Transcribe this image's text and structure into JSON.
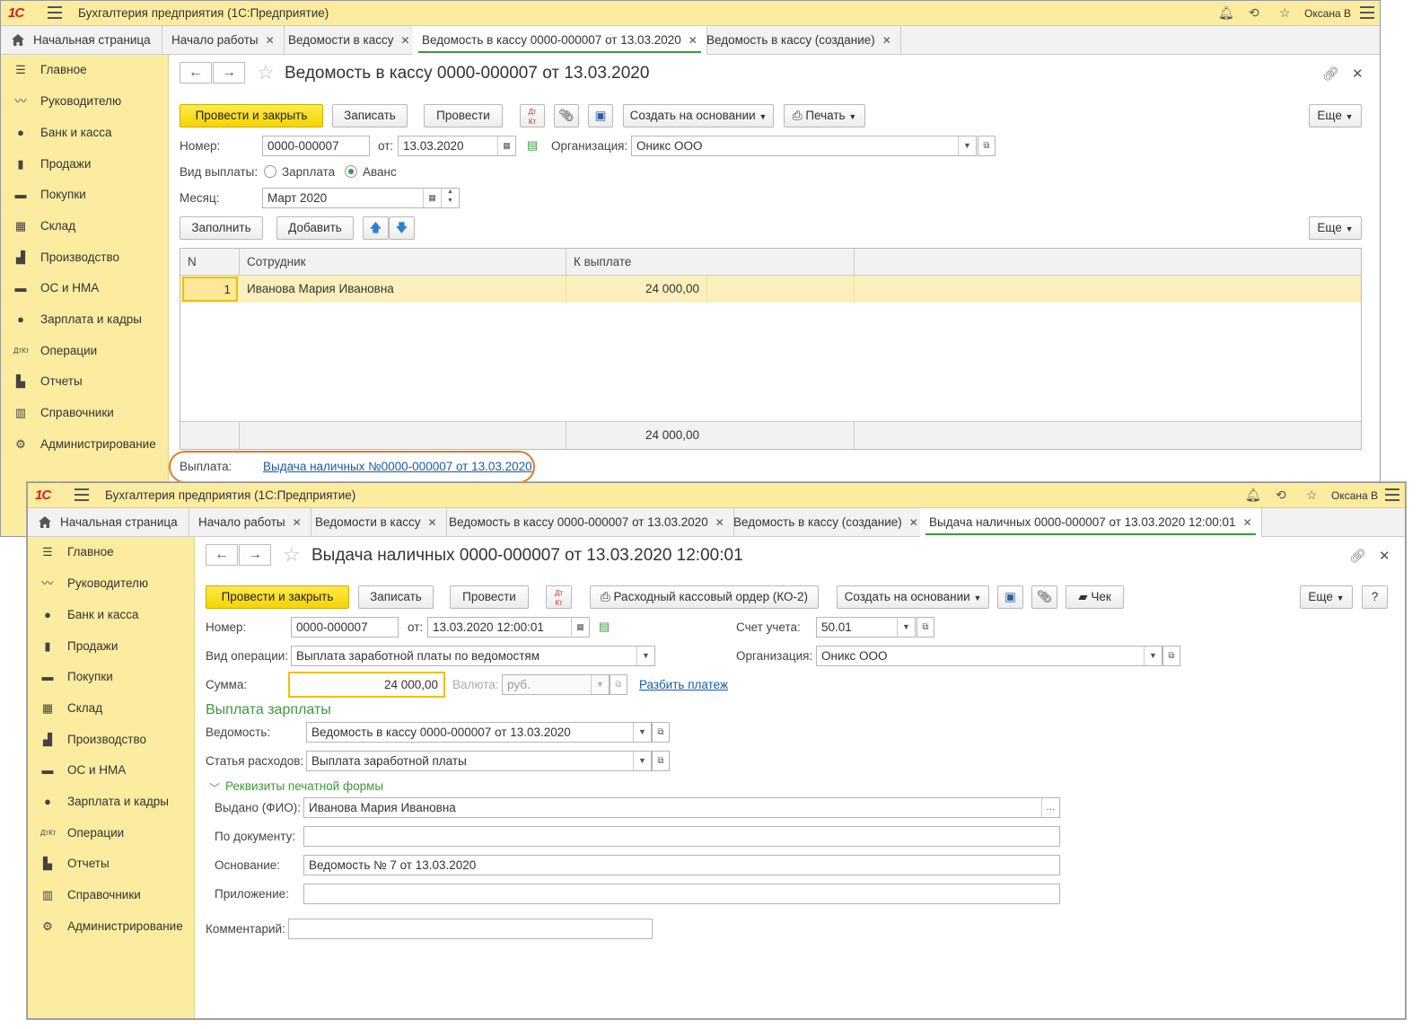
{
  "w1": {
    "app_title": "Бухгалтерия предприятия  (1С:Предприятие)",
    "user": "Оксана В",
    "home": "Начальная страница",
    "tabs": [
      "Начало работы",
      "Ведомости в кассу",
      "Ведомость в кассу 0000-000007 от 13.03.2020",
      "Ведомость в кассу (создание)"
    ],
    "sidebar": [
      "Главное",
      "Руководителю",
      "Банк и касса",
      "Продажи",
      "Покупки",
      "Склад",
      "Производство",
      "ОС и НМА",
      "Зарплата и кадры",
      "Операции",
      "Отчеты",
      "Справочники",
      "Администрирование"
    ],
    "doc_title": "Ведомость в кассу 0000-000007 от 13.03.2020",
    "btn_post_close": "Провести и закрыть",
    "btn_save": "Записать",
    "btn_post": "Провести",
    "btn_create_based": "Создать на основании",
    "btn_print": "Печать",
    "btn_more": "Еще",
    "number_label": "Номер:",
    "number": "0000-000007",
    "date_label": "от:",
    "date": "13.03.2020",
    "org_label": "Организация:",
    "org": "Оникс ООО",
    "pay_type_label": "Вид выплаты:",
    "pay_type_salary": "Зарплата",
    "pay_type_advance": "Аванс",
    "month_label": "Месяц:",
    "month": "Март 2020",
    "btn_fill": "Заполнить",
    "btn_add": "Добавить",
    "table_headers": [
      "N",
      "Сотрудник",
      "К выплате"
    ],
    "row": {
      "n": "1",
      "employee": "Иванова Мария Ивановна",
      "amount": "24 000,00"
    },
    "total": "24 000,00",
    "payment_label": "Выплата:",
    "payment_link": "Выдача наличных №0000-000007 от 13.03.2020"
  },
  "w2": {
    "app_title": "Бухгалтерия предприятия  (1С:Предприятие)",
    "user": "Оксана В",
    "home": "Начальная страница",
    "tabs": [
      "Начало работы",
      "Ведомости в кассу",
      "Ведомость в кассу 0000-000007 от 13.03.2020",
      "Ведомость в кассу (создание)",
      "Выдача наличных 0000-000007 от 13.03.2020 12:00:01"
    ],
    "sidebar": [
      "Главное",
      "Руководителю",
      "Банк и касса",
      "Продажи",
      "Покупки",
      "Склад",
      "Производство",
      "ОС и НМА",
      "Зарплата и кадры",
      "Операции",
      "Отчеты",
      "Справочники",
      "Администрирование"
    ],
    "doc_title": "Выдача наличных 0000-000007 от 13.03.2020 12:00:01",
    "btn_post_close": "Провести и закрыть",
    "btn_save": "Записать",
    "btn_post": "Провести",
    "btn_ko2": "Расходный кассовый ордер (КО-2)",
    "btn_create_based": "Создать на основании",
    "btn_check": "Чек",
    "btn_more": "Еще",
    "btn_help": "?",
    "number_label": "Номер:",
    "number": "0000-000007",
    "date_label": "от:",
    "date": "13.03.2020 12:00:01",
    "account_label": "Счет учета:",
    "account": "50.01",
    "op_type_label": "Вид операции:",
    "op_type": "Выплата заработной платы по ведомостям",
    "org_label": "Организация:",
    "org": "Оникс ООО",
    "sum_label": "Сумма:",
    "sum": "24 000,00",
    "currency_label": "Валюта:",
    "currency": "руб.",
    "split_link": "Разбить платеж",
    "section_title": "Выплата зарплаты",
    "statement_label": "Ведомость:",
    "statement": "Ведомость в кассу 0000-000007 от 13.03.2020",
    "expense_label": "Статья расходов:",
    "expense": "Выплата заработной платы",
    "print_section": "Реквизиты печатной формы",
    "issued_label": "Выдано (ФИО):",
    "issued": "Иванова Мария Ивановна",
    "by_doc_label": "По документу:",
    "by_doc": "",
    "basis_label": "Основание:",
    "basis": "Ведомость № 7 от 13.03.2020",
    "attach_label": "Приложение:",
    "attach": "",
    "comment_label": "Комментарий:",
    "comment": ""
  }
}
